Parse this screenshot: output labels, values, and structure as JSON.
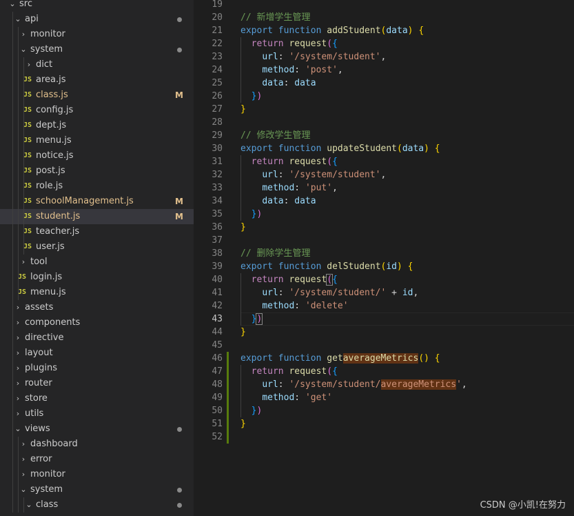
{
  "explorer": {
    "items": [
      {
        "label": "src",
        "kind": "folder",
        "open": true,
        "depth": 0
      },
      {
        "label": "api",
        "kind": "folder",
        "open": true,
        "depth": 1,
        "dot": true
      },
      {
        "label": "monitor",
        "kind": "folder",
        "open": false,
        "depth": 2
      },
      {
        "label": "system",
        "kind": "folder",
        "open": true,
        "depth": 2,
        "dot": true
      },
      {
        "label": "dict",
        "kind": "folder",
        "open": false,
        "depth": 3
      },
      {
        "label": "area.js",
        "kind": "js",
        "depth": 3
      },
      {
        "label": "class.js",
        "kind": "js",
        "depth": 3,
        "badge": "M"
      },
      {
        "label": "config.js",
        "kind": "js",
        "depth": 3
      },
      {
        "label": "dept.js",
        "kind": "js",
        "depth": 3
      },
      {
        "label": "menu.js",
        "kind": "js",
        "depth": 3
      },
      {
        "label": "notice.js",
        "kind": "js",
        "depth": 3
      },
      {
        "label": "post.js",
        "kind": "js",
        "depth": 3
      },
      {
        "label": "role.js",
        "kind": "js",
        "depth": 3
      },
      {
        "label": "schoolManagement.js",
        "kind": "js",
        "depth": 3,
        "badge": "M"
      },
      {
        "label": "student.js",
        "kind": "js",
        "depth": 3,
        "badge": "M",
        "selected": true
      },
      {
        "label": "teacher.js",
        "kind": "js",
        "depth": 3
      },
      {
        "label": "user.js",
        "kind": "js",
        "depth": 3
      },
      {
        "label": "tool",
        "kind": "folder",
        "open": false,
        "depth": 2
      },
      {
        "label": "login.js",
        "kind": "js",
        "depth": 2
      },
      {
        "label": "menu.js",
        "kind": "js",
        "depth": 2
      },
      {
        "label": "assets",
        "kind": "folder",
        "open": false,
        "depth": 1
      },
      {
        "label": "components",
        "kind": "folder",
        "open": false,
        "depth": 1
      },
      {
        "label": "directive",
        "kind": "folder",
        "open": false,
        "depth": 1
      },
      {
        "label": "layout",
        "kind": "folder",
        "open": false,
        "depth": 1
      },
      {
        "label": "plugins",
        "kind": "folder",
        "open": false,
        "depth": 1
      },
      {
        "label": "router",
        "kind": "folder",
        "open": false,
        "depth": 1
      },
      {
        "label": "store",
        "kind": "folder",
        "open": false,
        "depth": 1
      },
      {
        "label": "utils",
        "kind": "folder",
        "open": false,
        "depth": 1
      },
      {
        "label": "views",
        "kind": "folder",
        "open": true,
        "depth": 1,
        "dot": true
      },
      {
        "label": "dashboard",
        "kind": "folder",
        "open": false,
        "depth": 2
      },
      {
        "label": "error",
        "kind": "folder",
        "open": false,
        "depth": 2
      },
      {
        "label": "monitor",
        "kind": "folder",
        "open": false,
        "depth": 2
      },
      {
        "label": "system",
        "kind": "folder",
        "open": true,
        "depth": 2,
        "dot": true
      },
      {
        "label": "class",
        "kind": "folder",
        "open": true,
        "depth": 3,
        "dot": true
      }
    ],
    "js_icon_text": "JS",
    "chevron_open": "⌄",
    "chevron_closed": "›"
  },
  "editor": {
    "file": "student.js",
    "cursor_line": "43",
    "lines": [
      {
        "n": "19",
        "t": []
      },
      {
        "n": "20",
        "t": [
          [
            "cm",
            "// 新增学生管理"
          ]
        ]
      },
      {
        "n": "21",
        "t": [
          [
            "kw",
            "export "
          ],
          [
            "kw",
            "function "
          ],
          [
            "fn",
            "addStudent"
          ],
          [
            "b1",
            "("
          ],
          [
            "pr",
            "data"
          ],
          [
            "b1",
            ")"
          ],
          [
            "p",
            " "
          ],
          [
            "b1",
            "{"
          ]
        ]
      },
      {
        "n": "22",
        "t": [
          [
            "p",
            "  "
          ],
          [
            "kw2",
            "return "
          ],
          [
            "fn",
            "request"
          ],
          [
            "b2",
            "("
          ],
          [
            "b3",
            "{"
          ]
        ]
      },
      {
        "n": "23",
        "t": [
          [
            "p",
            "    "
          ],
          [
            "pr",
            "url"
          ],
          [
            "p",
            ": "
          ],
          [
            "str",
            "'/system/student'"
          ],
          [
            "p",
            ","
          ]
        ]
      },
      {
        "n": "24",
        "t": [
          [
            "p",
            "    "
          ],
          [
            "pr",
            "method"
          ],
          [
            "p",
            ": "
          ],
          [
            "str",
            "'post'"
          ],
          [
            "p",
            ","
          ]
        ]
      },
      {
        "n": "25",
        "t": [
          [
            "p",
            "    "
          ],
          [
            "pr",
            "data"
          ],
          [
            "p",
            ": "
          ],
          [
            "pr",
            "data"
          ]
        ]
      },
      {
        "n": "26",
        "t": [
          [
            "p",
            "  "
          ],
          [
            "b3",
            "}"
          ],
          [
            "b2",
            ")"
          ]
        ]
      },
      {
        "n": "27",
        "t": [
          [
            "b1",
            "}"
          ]
        ]
      },
      {
        "n": "28",
        "t": []
      },
      {
        "n": "29",
        "t": [
          [
            "cm",
            "// 修改学生管理"
          ]
        ]
      },
      {
        "n": "30",
        "t": [
          [
            "kw",
            "export "
          ],
          [
            "kw",
            "function "
          ],
          [
            "fn",
            "updateStudent"
          ],
          [
            "b1",
            "("
          ],
          [
            "pr",
            "data"
          ],
          [
            "b1",
            ")"
          ],
          [
            "p",
            " "
          ],
          [
            "b1",
            "{"
          ]
        ]
      },
      {
        "n": "31",
        "t": [
          [
            "p",
            "  "
          ],
          [
            "kw2",
            "return "
          ],
          [
            "fn",
            "request"
          ],
          [
            "b2",
            "("
          ],
          [
            "b3",
            "{"
          ]
        ]
      },
      {
        "n": "32",
        "t": [
          [
            "p",
            "    "
          ],
          [
            "pr",
            "url"
          ],
          [
            "p",
            ": "
          ],
          [
            "str",
            "'/system/student'"
          ],
          [
            "p",
            ","
          ]
        ]
      },
      {
        "n": "33",
        "t": [
          [
            "p",
            "    "
          ],
          [
            "pr",
            "method"
          ],
          [
            "p",
            ": "
          ],
          [
            "str",
            "'put'"
          ],
          [
            "p",
            ","
          ]
        ]
      },
      {
        "n": "34",
        "t": [
          [
            "p",
            "    "
          ],
          [
            "pr",
            "data"
          ],
          [
            "p",
            ": "
          ],
          [
            "pr",
            "data"
          ]
        ]
      },
      {
        "n": "35",
        "t": [
          [
            "p",
            "  "
          ],
          [
            "b3",
            "}"
          ],
          [
            "b2",
            ")"
          ]
        ]
      },
      {
        "n": "36",
        "t": [
          [
            "b1",
            "}"
          ]
        ]
      },
      {
        "n": "37",
        "t": []
      },
      {
        "n": "38",
        "t": [
          [
            "cm",
            "// 删除学生管理"
          ]
        ]
      },
      {
        "n": "39",
        "t": [
          [
            "kw",
            "export "
          ],
          [
            "kw",
            "function "
          ],
          [
            "fn",
            "delStudent"
          ],
          [
            "b1",
            "("
          ],
          [
            "pr",
            "id"
          ],
          [
            "b1",
            ")"
          ],
          [
            "p",
            " "
          ],
          [
            "b1",
            "{"
          ]
        ]
      },
      {
        "n": "40",
        "t": [
          [
            "p",
            "  "
          ],
          [
            "kw2",
            "return "
          ],
          [
            "fn",
            "request"
          ],
          [
            "b2bm",
            "("
          ],
          [
            "b3",
            "{"
          ]
        ]
      },
      {
        "n": "41",
        "t": [
          [
            "p",
            "    "
          ],
          [
            "pr",
            "url"
          ],
          [
            "p",
            ": "
          ],
          [
            "str",
            "'/system/student/'"
          ],
          [
            "p",
            " + "
          ],
          [
            "pr",
            "id"
          ],
          [
            "p",
            ","
          ]
        ]
      },
      {
        "n": "42",
        "t": [
          [
            "p",
            "    "
          ],
          [
            "pr",
            "method"
          ],
          [
            "p",
            ": "
          ],
          [
            "str",
            "'delete'"
          ]
        ]
      },
      {
        "n": "43",
        "t": [
          [
            "p",
            "  "
          ],
          [
            "b3",
            "}"
          ],
          [
            "b2bm",
            ")"
          ]
        ]
      },
      {
        "n": "44",
        "t": [
          [
            "b1",
            "}"
          ]
        ]
      },
      {
        "n": "45",
        "t": []
      },
      {
        "n": "46",
        "t": [
          [
            "kw",
            "export "
          ],
          [
            "kw",
            "function "
          ],
          [
            "fn",
            "get"
          ],
          [
            "fnhl",
            "averageMetrics"
          ],
          [
            "b1",
            "("
          ],
          [
            "b1",
            ")"
          ],
          [
            "p",
            " "
          ],
          [
            "b1",
            "{"
          ]
        ]
      },
      {
        "n": "47",
        "t": [
          [
            "p",
            "  "
          ],
          [
            "kw2",
            "return "
          ],
          [
            "fn",
            "request"
          ],
          [
            "b2",
            "("
          ],
          [
            "b3",
            "{"
          ]
        ]
      },
      {
        "n": "48",
        "t": [
          [
            "p",
            "    "
          ],
          [
            "pr",
            "url"
          ],
          [
            "p",
            ": "
          ],
          [
            "str",
            "'/system/student/"
          ],
          [
            "strhl",
            "averageMetrics"
          ],
          [
            "str",
            "'"
          ],
          [
            "p",
            ","
          ]
        ]
      },
      {
        "n": "49",
        "t": [
          [
            "p",
            "    "
          ],
          [
            "pr",
            "method"
          ],
          [
            "p",
            ": "
          ],
          [
            "str",
            "'get'"
          ]
        ]
      },
      {
        "n": "50",
        "t": [
          [
            "p",
            "  "
          ],
          [
            "b3",
            "}"
          ],
          [
            "b2",
            ")"
          ]
        ]
      },
      {
        "n": "51",
        "t": [
          [
            "b1",
            "}"
          ]
        ]
      },
      {
        "n": "52",
        "t": []
      }
    ]
  },
  "watermark": "CSDN @小凯!在努力"
}
